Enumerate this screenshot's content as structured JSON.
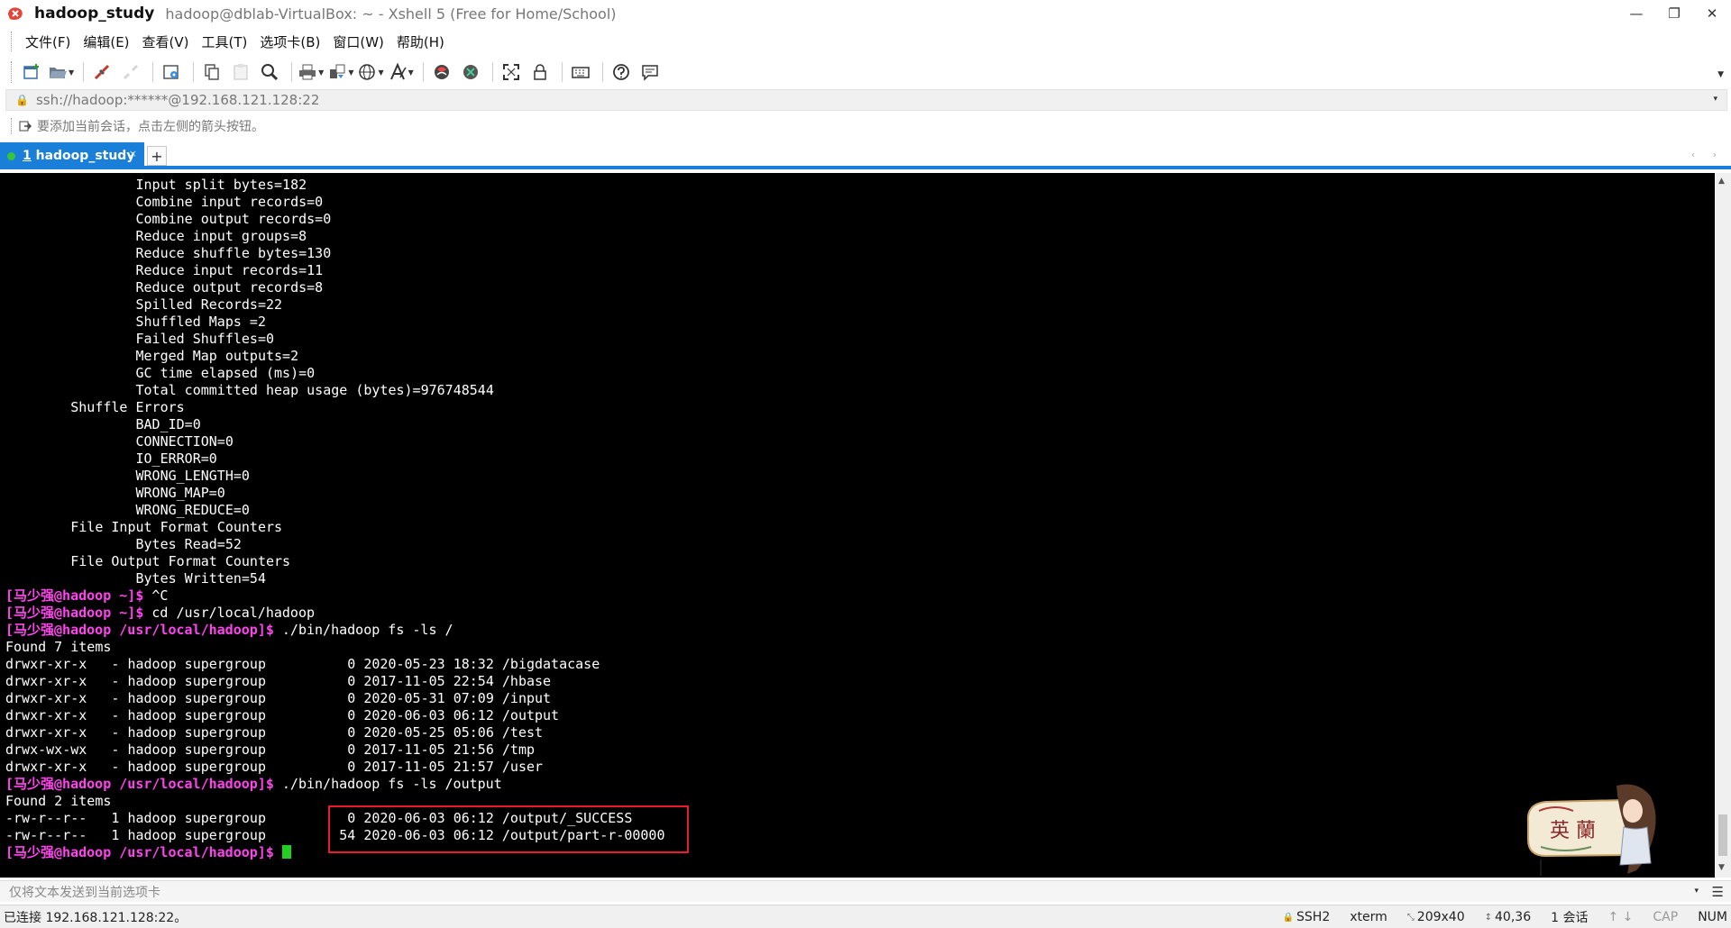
{
  "window": {
    "title": "hadoop_study",
    "subtitle": "hadoop@dblab-VirtualBox: ~ - Xshell 5 (Free for Home/School)",
    "minimize": "—",
    "restore": "❐",
    "close": "✕"
  },
  "menu": [
    "文件(F)",
    "编辑(E)",
    "查看(V)",
    "工具(T)",
    "选项卡(B)",
    "窗口(W)",
    "帮助(H)"
  ],
  "address": {
    "lock_icon": "🔒",
    "value": "ssh://hadoop:******@192.168.121.128:22",
    "dropdown": "▾"
  },
  "hint": "要添加当前会话，点击左侧的箭头按钮。",
  "tabs": {
    "active_number": "1",
    "active_name": " hadoop_study",
    "close_label": "×",
    "add_label": "+",
    "nav": "‹ ›"
  },
  "terminal": {
    "lines": [
      [
        {
          "t": "                Input split bytes=182"
        }
      ],
      [
        {
          "t": "                Combine input records=0"
        }
      ],
      [
        {
          "t": "                Combine output records=0"
        }
      ],
      [
        {
          "t": "                Reduce input groups=8"
        }
      ],
      [
        {
          "t": "                Reduce shuffle bytes=130"
        }
      ],
      [
        {
          "t": "                Reduce input records=11"
        }
      ],
      [
        {
          "t": "                Reduce output records=8"
        }
      ],
      [
        {
          "t": "                Spilled Records=22"
        }
      ],
      [
        {
          "t": "                Shuffled Maps =2"
        }
      ],
      [
        {
          "t": "                Failed Shuffles=0"
        }
      ],
      [
        {
          "t": "                Merged Map outputs=2"
        }
      ],
      [
        {
          "t": "                GC time elapsed (ms)=0"
        }
      ],
      [
        {
          "t": "                Total committed heap usage (bytes)=976748544"
        }
      ],
      [
        {
          "t": "        Shuffle Errors"
        }
      ],
      [
        {
          "t": "                BAD_ID=0"
        }
      ],
      [
        {
          "t": "                CONNECTION=0"
        }
      ],
      [
        {
          "t": "                IO_ERROR=0"
        }
      ],
      [
        {
          "t": "                WRONG_LENGTH=0"
        }
      ],
      [
        {
          "t": "                WRONG_MAP=0"
        }
      ],
      [
        {
          "t": "                WRONG_REDUCE=0"
        }
      ],
      [
        {
          "t": "        File Input Format Counters"
        }
      ],
      [
        {
          "t": "                Bytes Read=52"
        }
      ],
      [
        {
          "t": "        File Output Format Counters"
        }
      ],
      [
        {
          "t": "                Bytes Written=54"
        }
      ],
      [
        {
          "t": "[马少强@hadoop ~]$",
          "c": "prompt"
        },
        {
          "t": " ^C"
        }
      ],
      [
        {
          "t": "[马少强@hadoop ~]$",
          "c": "prompt"
        },
        {
          "t": " cd /usr/local/hadoop"
        }
      ],
      [
        {
          "t": "[马少强@hadoop /usr/local/hadoop]$",
          "c": "prompt"
        },
        {
          "t": " ./bin/hadoop fs -ls /"
        }
      ],
      [
        {
          "t": "Found 7 items"
        }
      ],
      [
        {
          "t": "drwxr-xr-x   - hadoop supergroup          0 2020-05-23 18:32 /bigdatacase"
        }
      ],
      [
        {
          "t": "drwxr-xr-x   - hadoop supergroup          0 2017-11-05 22:54 /hbase"
        }
      ],
      [
        {
          "t": "drwxr-xr-x   - hadoop supergroup          0 2020-05-31 07:09 /input"
        }
      ],
      [
        {
          "t": "drwxr-xr-x   - hadoop supergroup          0 2020-06-03 06:12 /output"
        }
      ],
      [
        {
          "t": "drwxr-xr-x   - hadoop supergroup          0 2020-05-25 05:06 /test"
        }
      ],
      [
        {
          "t": "drwx-wx-wx   - hadoop supergroup          0 2017-11-05 21:56 /tmp"
        }
      ],
      [
        {
          "t": "drwxr-xr-x   - hadoop supergroup          0 2017-11-05 21:57 /user"
        }
      ],
      [
        {
          "t": "[马少强@hadoop /usr/local/hadoop]$",
          "c": "prompt"
        },
        {
          "t": " ./bin/hadoop fs -ls /output"
        }
      ],
      [
        {
          "t": "Found 2 items"
        }
      ],
      [
        {
          "t": "-rw-r--r--   1 hadoop supergroup          0 2020-06-03 06:12 /output/_SUCCESS"
        }
      ],
      [
        {
          "t": "-rw-r--r--   1 hadoop supergroup         54 2020-06-03 06:12 /output/part-r-00000"
        }
      ],
      [
        {
          "t": "[马少强@hadoop /usr/local/hadoop]$",
          "c": "prompt"
        },
        {
          "t": " "
        },
        {
          "c": "cursor"
        }
      ]
    ],
    "stamp_text": "英 蘭",
    "colors": {
      "background": "#000000",
      "text": "#ffffff",
      "prompt": "#ff44ee",
      "cursor": "#22d022",
      "highlight": "#ea1b2a"
    }
  },
  "scrollbar": {
    "up": "▲",
    "down": "▼"
  },
  "sendbar": {
    "placeholder": "仅将文本发送到当前选项卡",
    "dropdown": "▾",
    "menu": "☰"
  },
  "status": {
    "connection": "已连接 192.168.121.128:22。",
    "protocol": "SSH2",
    "terminal_type": "xterm",
    "size": "209x40",
    "position": "40,36",
    "sessions": "1 会话",
    "caps": "CAP",
    "num": "NUM"
  }
}
